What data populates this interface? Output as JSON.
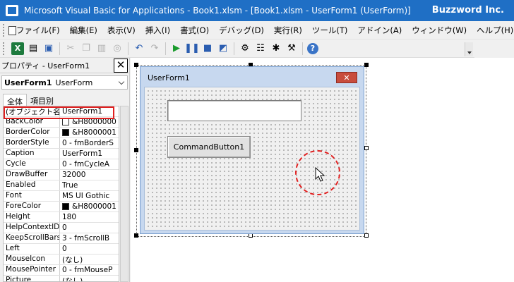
{
  "window": {
    "title": "Microsoft Visual Basic for Applications - Book1.xlsm - [Book1.xlsm - UserForm1 (UserForm)]",
    "brand": "Buzzword Inc."
  },
  "menu": {
    "items": [
      "ファイル(F)",
      "編集(E)",
      "表示(V)",
      "挿入(I)",
      "書式(O)",
      "デバッグ(D)",
      "実行(R)",
      "ツール(T)",
      "アドイン(A)",
      "ウィンドウ(W)",
      "ヘルプ(H)"
    ]
  },
  "toolbar": {
    "icons": [
      "excel-icon",
      "insert-userform-icon",
      "save-icon",
      "cut-icon",
      "copy-icon",
      "paste-icon",
      "find-icon",
      "undo-icon",
      "redo-icon",
      "run-icon",
      "break-icon",
      "reset-icon",
      "design-mode-icon",
      "project-explorer-icon",
      "properties-icon",
      "object-browser-icon",
      "toolbox-icon",
      "help-icon"
    ]
  },
  "properties": {
    "header": "プロパティ - UserForm1",
    "close_label": "✕",
    "object_name": "UserForm1",
    "object_type": "UserForm",
    "tabs": [
      "全体",
      "項目別"
    ],
    "rows": [
      {
        "name": "(オブジェクト名)",
        "value": "UserForm1",
        "swatch": ""
      },
      {
        "name": "BackColor",
        "value": "&H8000000",
        "swatch": "white"
      },
      {
        "name": "BorderColor",
        "value": "&H8000001",
        "swatch": "black"
      },
      {
        "name": "BorderStyle",
        "value": "0 - fmBorderS",
        "swatch": ""
      },
      {
        "name": "Caption",
        "value": "UserForm1",
        "swatch": ""
      },
      {
        "name": "Cycle",
        "value": "0 - fmCycleA",
        "swatch": ""
      },
      {
        "name": "DrawBuffer",
        "value": "32000",
        "swatch": ""
      },
      {
        "name": "Enabled",
        "value": "True",
        "swatch": ""
      },
      {
        "name": "Font",
        "value": "MS UI Gothic",
        "swatch": ""
      },
      {
        "name": "ForeColor",
        "value": "&H8000001",
        "swatch": "black"
      },
      {
        "name": "Height",
        "value": "180",
        "swatch": ""
      },
      {
        "name": "HelpContextID",
        "value": "0",
        "swatch": ""
      },
      {
        "name": "KeepScrollBars",
        "value": "3 - fmScrollB",
        "swatch": ""
      },
      {
        "name": "Left",
        "value": "0",
        "swatch": ""
      },
      {
        "name": "MouseIcon",
        "value": "(なし)",
        "swatch": ""
      },
      {
        "name": "MousePointer",
        "value": "0 - fmMouseP",
        "swatch": ""
      },
      {
        "name": "Picture",
        "value": "(なし)",
        "swatch": ""
      }
    ]
  },
  "form": {
    "caption": "UserForm1",
    "close_label": "✕",
    "textbox_value": "",
    "button_label": "CommandButton1"
  },
  "colors": {
    "title_bar": "#1f6fc5",
    "highlight": "#e02020"
  }
}
